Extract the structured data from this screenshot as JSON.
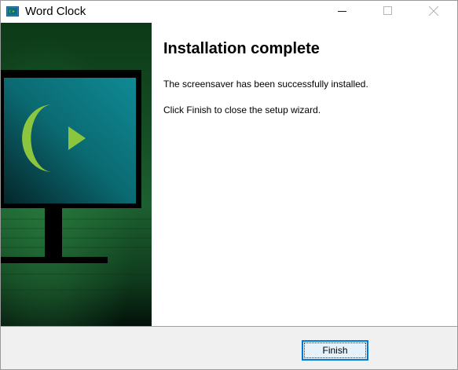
{
  "window": {
    "title": "Word Clock",
    "icon": "monitor-app-icon"
  },
  "caption_buttons": {
    "minimize": "minimize-icon",
    "maximize": "maximize-icon",
    "close": "close-icon"
  },
  "banner": {
    "image": "monitor-with-crescent-play-logo",
    "colors": {
      "green_dark": "#0b2a12",
      "green_mid": "#1f6a33",
      "teal": "#0b6f7c",
      "logo_green": "#8cc63f",
      "stand": "#000000"
    }
  },
  "content": {
    "heading": "Installation complete",
    "message_line1": "The screensaver has been successfully installed.",
    "message_line2": "Click Finish to close the setup wizard."
  },
  "footer": {
    "finish_label": "Finish",
    "accent_color": "#0078d7"
  }
}
